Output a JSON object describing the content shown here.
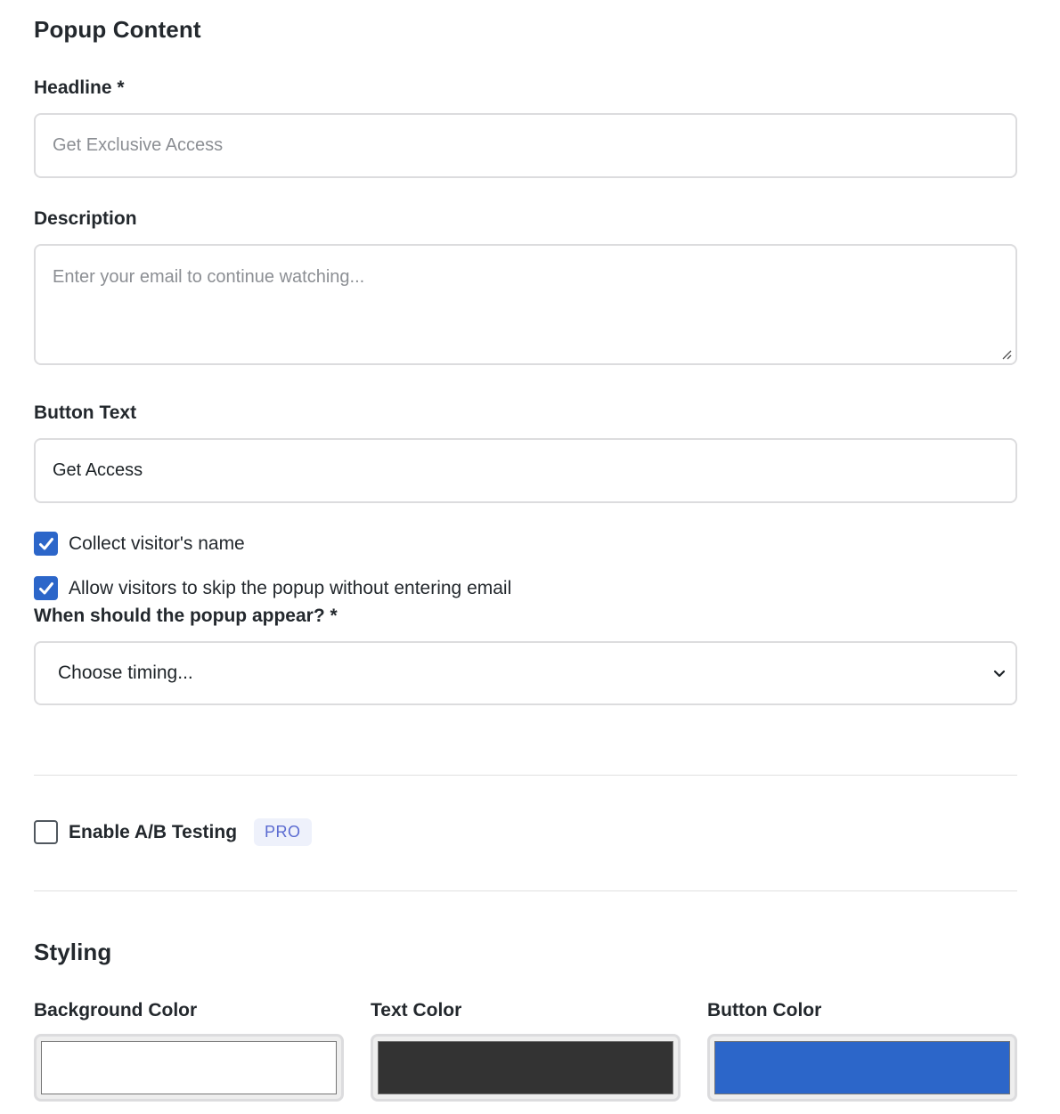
{
  "popup_content": {
    "heading": "Popup Content",
    "headline": {
      "label": "Headline *",
      "placeholder": "Get Exclusive Access",
      "value": ""
    },
    "description": {
      "label": "Description",
      "placeholder": "Enter your email to continue watching...",
      "value": ""
    },
    "button_text": {
      "label": "Button Text",
      "value": "Get Access"
    },
    "collect_name": {
      "label": "Collect visitor's name",
      "checked": true
    },
    "allow_skip": {
      "label": "Allow visitors to skip the popup without entering email",
      "checked": true
    },
    "timing": {
      "label": "When should the popup appear? *",
      "selected": "Choose timing..."
    }
  },
  "ab_testing": {
    "label": "Enable A/B Testing",
    "checked": false,
    "badge": "PRO"
  },
  "styling": {
    "heading": "Styling",
    "background_color": {
      "label": "Background Color",
      "value": "#ffffff"
    },
    "text_color": {
      "label": "Text Color",
      "value": "#333333"
    },
    "button_color": {
      "label": "Button Color",
      "value": "#2c66c9"
    }
  },
  "colors": {
    "accent": "#2c66c9",
    "border": "#dcdcde",
    "badge_bg": "#eef1fb",
    "badge_text": "#5b6bd1"
  }
}
